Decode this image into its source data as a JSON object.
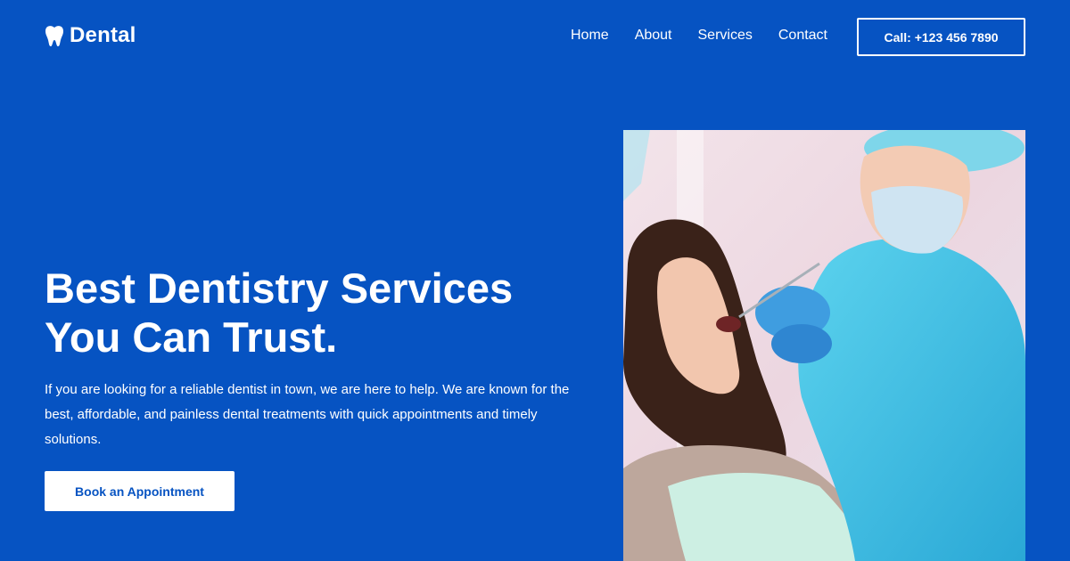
{
  "brand": {
    "logo_icon": "tooth-icon",
    "name": "Dental"
  },
  "nav": {
    "items": [
      {
        "label": "Home"
      },
      {
        "label": "About"
      },
      {
        "label": "Services"
      },
      {
        "label": "Contact"
      }
    ],
    "cta_label": "Call: +123 456 7890"
  },
  "hero": {
    "title_line1": "Best Dentistry Services",
    "title_line2": "You Can Trust.",
    "description": "If you are looking for a reliable dentist in town, we are here to help. We are known for the best, affordable, and painless dental treatments with quick appointments and timely solutions.",
    "button_label": "Book an Appointment",
    "image_subject": "dentist-examining-patient-photo"
  },
  "colors": {
    "background": "#0653c2",
    "text": "#ffffff",
    "button_text": "#0653c2"
  }
}
